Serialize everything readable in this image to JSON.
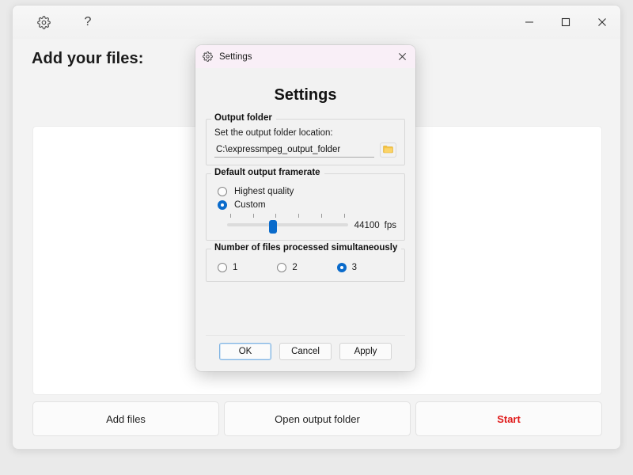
{
  "app": {
    "titlebar": {
      "settings_icon": "gear-icon",
      "help_icon": "question-mark-icon",
      "minimize_label": "Minimize",
      "maximize_label": "Maximize",
      "close_label": "Close"
    },
    "page_title": "Add your files:",
    "file_list_items": [],
    "bottom_buttons": [
      {
        "label": "Add files",
        "name": "add-files-button",
        "accent": false
      },
      {
        "label": "Open output folder",
        "name": "open-output-folder-button",
        "accent": false
      },
      {
        "label": "Start",
        "name": "start-button",
        "accent": true
      }
    ]
  },
  "dialog": {
    "titlebar_icon": "gear-icon",
    "titlebar_text": "Settings",
    "close_label": "Close",
    "heading": "Settings",
    "output_folder": {
      "legend": "Output folder",
      "field_label": "Set the output folder location:",
      "path_value": "C:\\expressmpeg_output_folder",
      "path_placeholder": "C:\\expressmpeg_output_folder",
      "browse_icon": "folder-icon"
    },
    "framerate": {
      "legend": "Default output framerate",
      "options": [
        {
          "label": "Highest quality",
          "selected": false
        },
        {
          "label": "Custom",
          "selected": true
        }
      ],
      "slider": {
        "value": "44100",
        "unit": "fps",
        "percent": 38,
        "tick_count": 6
      }
    },
    "simultaneous": {
      "legend": "Number of files processed simultaneously",
      "options": [
        {
          "label": "1",
          "selected": false
        },
        {
          "label": "2",
          "selected": false
        },
        {
          "label": "3",
          "selected": true
        }
      ]
    },
    "footer_buttons": [
      {
        "label": "OK",
        "name": "ok-button",
        "focused": true
      },
      {
        "label": "Cancel",
        "name": "cancel-button",
        "focused": false
      },
      {
        "label": "Apply",
        "name": "apply-button",
        "focused": false
      }
    ]
  },
  "colors": {
    "accent_blue": "#0a6bcb",
    "start_red": "#e01b1b",
    "dialog_titlebar": "#f9eff7",
    "window_bg": "#f3f3f3",
    "folder_yellow": "#f4c344"
  }
}
